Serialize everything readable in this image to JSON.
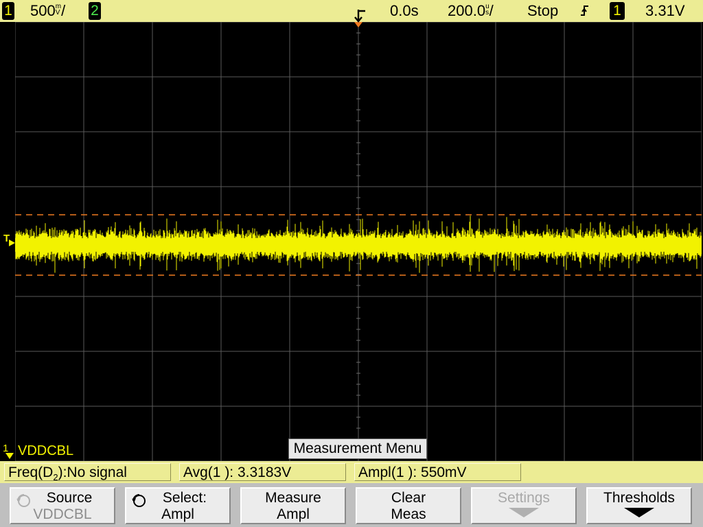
{
  "status_bar": {
    "ch1_number": "1",
    "ch1_scale": "500",
    "ch1_scale_unit_top": "m",
    "ch1_scale_unit_bottom": "V",
    "ch1_scale_suffix": "/",
    "ch2_number": "2",
    "delay": "0.0s",
    "timebase": "200.0",
    "timebase_unit_top": "u",
    "timebase_unit_bottom": "s",
    "timebase_suffix": "/",
    "run_state": "Stop",
    "trigger_slope_icon": "rising-edge-icon",
    "trigger_source": "1",
    "trigger_level": "3.31V"
  },
  "screen": {
    "trigger_level_marker": "T",
    "channel_marker": "1",
    "channel_label": "VDDCBL",
    "menu_title": "Measurement Menu"
  },
  "measurements": [
    {
      "prefix": "Freq(D",
      "subscript": "2",
      "suffix": "):No signal"
    },
    {
      "text": "Avg(1 ): 3.3183V"
    },
    {
      "text": "Ampl(1 ): 550mV"
    }
  ],
  "softkeys": [
    {
      "line1": "Source",
      "line2": "VDDCBL",
      "icon": "entry-knob-icon",
      "enabled": true
    },
    {
      "line1": "Select:",
      "line2": "Ampl",
      "icon": "entry-knob-icon",
      "enabled": true
    },
    {
      "line1": "Measure",
      "line2": "Ampl",
      "enabled": true
    },
    {
      "line1": "Clear",
      "line2": "Meas",
      "enabled": true
    },
    {
      "line1": "Settings",
      "icon": "submenu-arrow-icon",
      "enabled": false
    },
    {
      "line1": "Thresholds",
      "icon": "submenu-arrow-icon",
      "enabled": true
    }
  ],
  "colors": {
    "status_bar_bg": "#ecec94",
    "channel1_trace": "#f2f200",
    "channel2": "#4de84d",
    "grid": "#5a5a5a",
    "cursor_lines": "#f07a20",
    "softkey_bg": "#ececec"
  }
}
